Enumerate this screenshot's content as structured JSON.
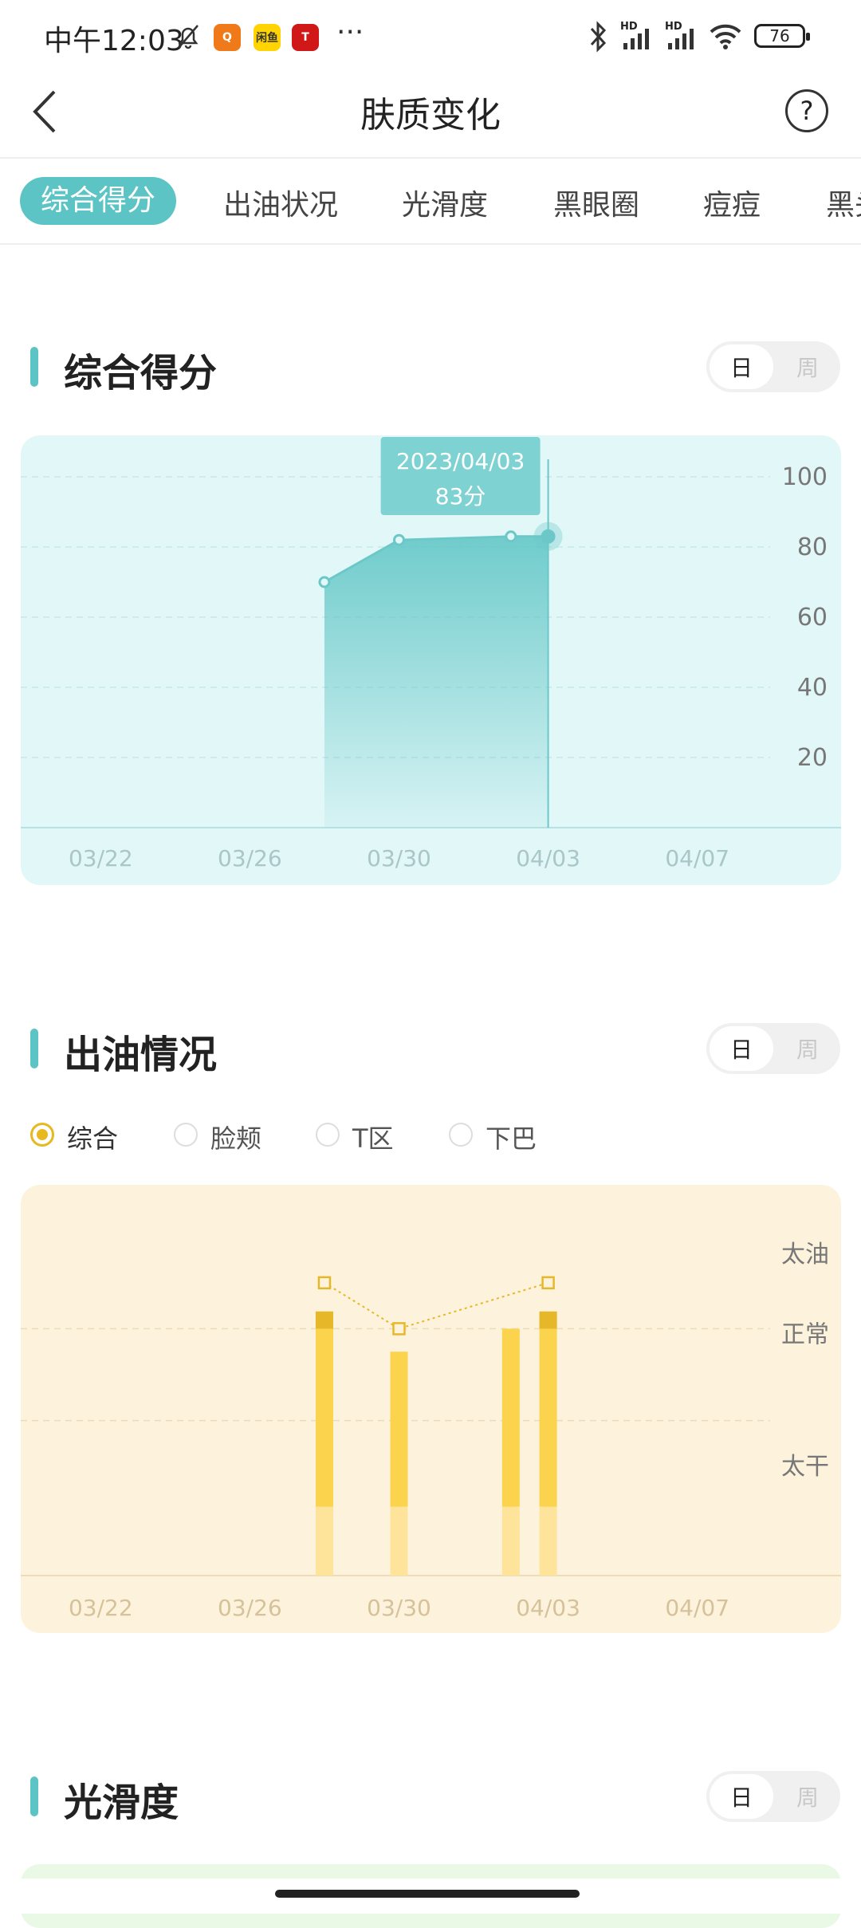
{
  "status_bar": {
    "time": "中午12:03",
    "apps": [
      "qq-app-icon",
      "taobao-app-icon",
      "tesla-app-icon"
    ],
    "taobao_label": "闲鱼",
    "more": "···",
    "hd1": "HD",
    "hd2": "HD",
    "battery": "76"
  },
  "header": {
    "title": "肤质变化",
    "back_icon": "chevron-left-icon",
    "help_label": "?"
  },
  "tabs": [
    "综合得分",
    "出油状况",
    "光滑度",
    "黑眼圈",
    "痘痘",
    "黑头"
  ],
  "sections": {
    "score": {
      "title": "综合得分",
      "toggle_day": "日",
      "toggle_week": "周"
    },
    "oil": {
      "title": "出油情况",
      "toggle_day": "日",
      "toggle_week": "周",
      "radios": [
        "综合",
        "脸颊",
        "T区",
        "下巴"
      ],
      "selected": "综合"
    },
    "smooth": {
      "title": "光滑度",
      "toggle_day": "日",
      "toggle_week": "周"
    }
  },
  "colors": {
    "accent": "#5cc4c4",
    "score_bg": "#e2f7f8",
    "oil_bg": "#fdf3dd",
    "oil_bar": "#fcd34d",
    "oil_top": "#e6b829"
  },
  "chart_data": [
    {
      "type": "area",
      "title": "综合得分",
      "x_ticks": [
        "03/22",
        "03/26",
        "03/30",
        "04/03",
        "04/07"
      ],
      "y_ticks": [
        100,
        80,
        60,
        40,
        20
      ],
      "ylim": [
        0,
        100
      ],
      "x_range": [
        "03/19",
        "04/10"
      ],
      "points": [
        {
          "x": "03/28",
          "y": 70
        },
        {
          "x": "03/30",
          "y": 82
        },
        {
          "x": "04/02",
          "y": 83
        },
        {
          "x": "04/03",
          "y": 83
        }
      ],
      "tooltip": {
        "date": "2023/04/03",
        "value": "83分"
      },
      "grid": true
    },
    {
      "type": "bar",
      "title": "出油情况",
      "x_ticks": [
        "03/22",
        "03/26",
        "03/30",
        "04/03",
        "04/07"
      ],
      "y_labels": [
        "太油",
        "正常",
        "太干"
      ],
      "x_range": [
        "03/19",
        "04/10"
      ],
      "bars": [
        {
          "x": "03/28",
          "level": 2.3
        },
        {
          "x": "03/30",
          "level": 1.95
        },
        {
          "x": "04/02",
          "level": 2.15
        },
        {
          "x": "04/03",
          "level": 2.3
        }
      ],
      "line_points": [
        {
          "x": "03/28",
          "level": 2.55
        },
        {
          "x": "03/30",
          "level": 2.15
        },
        {
          "x": "04/03",
          "level": 2.55
        }
      ],
      "grid": true
    }
  ]
}
